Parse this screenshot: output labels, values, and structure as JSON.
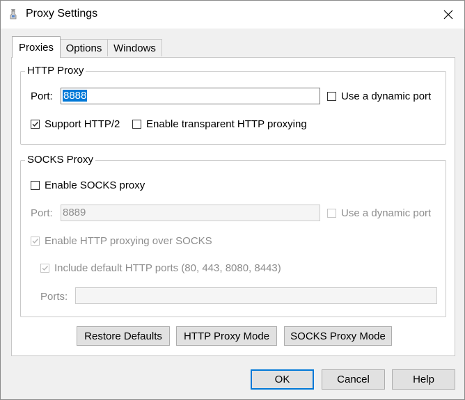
{
  "window": {
    "title": "Proxy Settings"
  },
  "tabs": [
    {
      "label": "Proxies",
      "active": true
    },
    {
      "label": "Options",
      "active": false
    },
    {
      "label": "Windows",
      "active": false
    }
  ],
  "http_proxy": {
    "group_label": "HTTP Proxy",
    "port_label": "Port:",
    "port_value": "8888",
    "dynamic_port_label": "Use a dynamic port",
    "dynamic_port_checked": false,
    "support_http2_label": "Support HTTP/2",
    "support_http2_checked": true,
    "transparent_label": "Enable transparent HTTP proxying",
    "transparent_checked": false
  },
  "socks_proxy": {
    "group_label": "SOCKS Proxy",
    "enable_label": "Enable SOCKS proxy",
    "enable_checked": false,
    "port_label": "Port:",
    "port_value": "8889",
    "dynamic_port_label": "Use a dynamic port",
    "dynamic_port_checked": false,
    "http_over_socks_label": "Enable HTTP proxying over SOCKS",
    "http_over_socks_checked": true,
    "include_ports_label": "Include default HTTP ports (80, 443, 8080, 8443)",
    "include_ports_checked": true,
    "ports_label": "Ports:",
    "ports_value": ""
  },
  "panel_buttons": {
    "restore": "Restore Defaults",
    "http_mode": "HTTP Proxy Mode",
    "socks_mode": "SOCKS Proxy Mode"
  },
  "dialog_buttons": {
    "ok": "OK",
    "cancel": "Cancel",
    "help": "Help"
  },
  "colors": {
    "accent": "#0078d7",
    "disabled_text": "#8d8d8d",
    "background": "#f0f0f0"
  }
}
